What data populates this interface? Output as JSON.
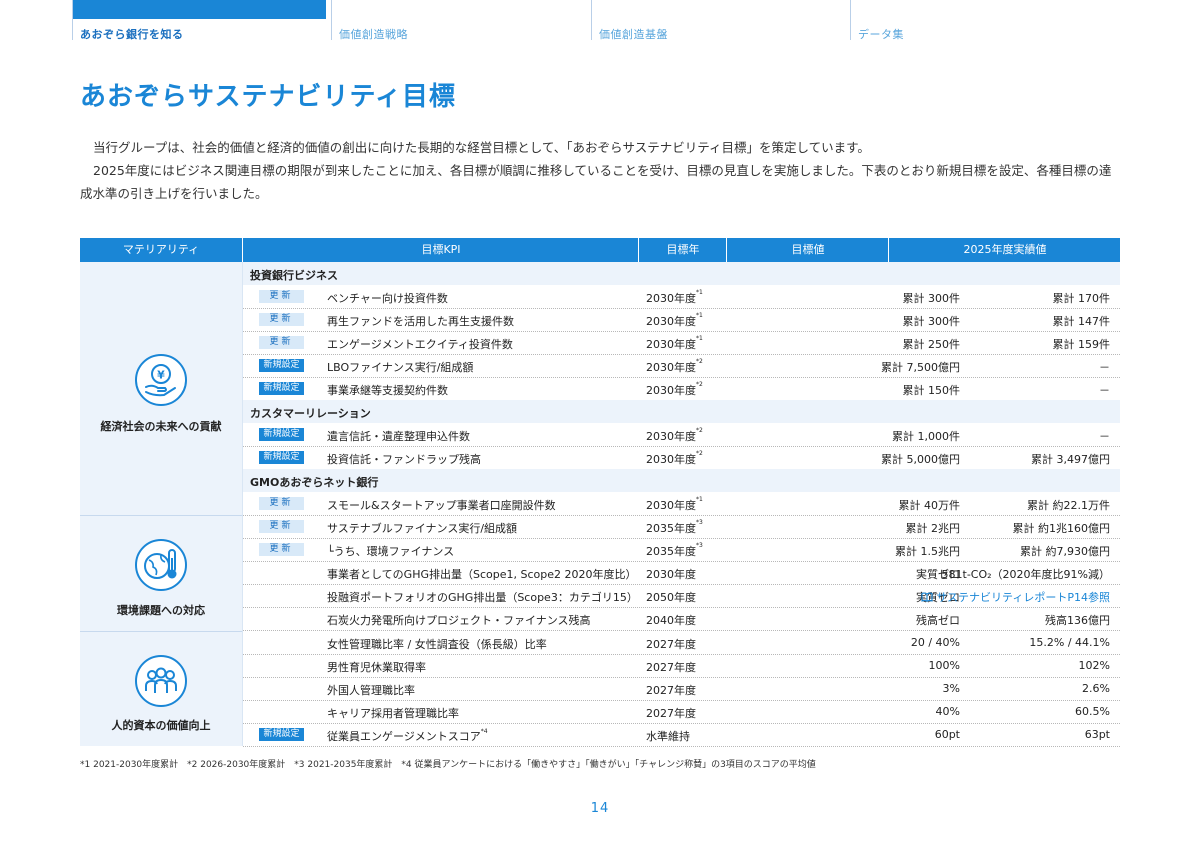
{
  "nav": {
    "tabs": [
      {
        "label": "あおぞら銀行を知る",
        "active": true
      },
      {
        "label": "価値創造戦略",
        "active": false
      },
      {
        "label": "価値創造基盤",
        "active": false
      },
      {
        "label": "データ集",
        "active": false
      }
    ]
  },
  "title": "あおぞらサステナビリティ目標",
  "intro": {
    "p1": "当行グループは、社会的価値と経済的価値の創出に向けた長期的な経営目標として、「あおぞらサステナビリティ目標」を策定しています。",
    "p2": "2025年度にはビジネス関連目標の期限が到来したことに加え、各目標が順調に推移していることを受け、目標の見直しを実施しました。下表のとおり新規目標を設定、各種目標の達成水準の引き上げを行いました。"
  },
  "table": {
    "headers": [
      "マテリアリティ",
      "目標KPI",
      "目標年",
      "目標値",
      "2025年度実績値"
    ],
    "materiality": [
      {
        "label": "経済社会の未来への貢献",
        "icon": "yen-hand-icon"
      },
      {
        "label": "環境課題への対応",
        "icon": "globe-thermometer-icon"
      },
      {
        "label": "人的資本の価値向上",
        "icon": "people-icon"
      }
    ],
    "groups": {
      "g1": "投資銀行ビジネス",
      "g2": "カスタマーリレーション",
      "g3": "GMOあおぞらネット銀行"
    },
    "badges": {
      "update": "更新",
      "new": "新規設定"
    },
    "rows": [
      {
        "kpi": "ベンチャー向け投資件数",
        "year": "2030年度",
        "note": "*1",
        "target": "累計 300件",
        "result": "累計 170件"
      },
      {
        "kpi": "再生ファンドを活用した再生支援件数",
        "year": "2030年度",
        "note": "*1",
        "target": "累計 300件",
        "result": "累計 147件"
      },
      {
        "kpi": "エンゲージメントエクイティ投資件数",
        "year": "2030年度",
        "note": "*1",
        "target": "累計 250件",
        "result": "累計 159件"
      },
      {
        "kpi": "LBOファイナンス実行/組成額",
        "year": "2030年度",
        "note": "*2",
        "target": "累計 7,500億円",
        "result": "－"
      },
      {
        "kpi": "事業承継等支援契約件数",
        "year": "2030年度",
        "note": "*2",
        "target": "累計 150件",
        "result": "－"
      },
      {
        "kpi": "遺言信託・遺産整理申込件数",
        "year": "2030年度",
        "note": "*2",
        "target": "累計 1,000件",
        "result": "－"
      },
      {
        "kpi": "投資信託・ファンドラップ残高",
        "year": "2030年度",
        "note": "*2",
        "target": "累計 5,000億円",
        "result": "累計 3,497億円"
      },
      {
        "kpi": "スモール&スタートアップ事業者口座開設件数",
        "year": "2030年度",
        "note": "*1",
        "target": "累計 40万件",
        "result": "累計 約22.1万件"
      },
      {
        "kpi": "サステナブルファイナンス実行/組成額",
        "year": "2035年度",
        "note": "*3",
        "target": "累計 2兆円",
        "result": "累計 約1兆160億円"
      },
      {
        "kpi": "└うち、環境ファイナンス",
        "year": "2035年度",
        "note": "*3",
        "target": "累計 1.5兆円",
        "result": "累計 約7,930億円"
      },
      {
        "kpi": "事業者としてのGHG排出量（Scope1, Scope2 2020年度比）",
        "year": "2030年度",
        "note": "",
        "target": "実質ゼロ",
        "result": "581t-CO₂（2020年度比91%減）"
      },
      {
        "kpi": "投融資ポートフォリオのGHG排出量（Scope3：カテゴリ15）",
        "year": "2050年度",
        "note": "",
        "target": "実質ゼロ",
        "result": "サステナビリティレポートP14参照"
      },
      {
        "kpi": "石炭火力発電所向けプロジェクト・ファイナンス残高",
        "year": "2040年度",
        "note": "",
        "target": "残高ゼロ",
        "result": "残高136億円"
      },
      {
        "kpi": "女性管理職比率 / 女性調査役（係長級）比率",
        "year": "2027年度",
        "note": "",
        "target": "20 / 40%",
        "result": "15.2% / 44.1%"
      },
      {
        "kpi": "男性育児休業取得率",
        "year": "2027年度",
        "note": "",
        "target": "100%",
        "result": "102%"
      },
      {
        "kpi": "外国人管理職比率",
        "year": "2027年度",
        "note": "",
        "target": "3%",
        "result": "2.6%"
      },
      {
        "kpi": "キャリア採用者管理職比率",
        "year": "2027年度",
        "note": "",
        "target": "40%",
        "result": "60.5%"
      },
      {
        "kpi": "従業員エンゲージメントスコア",
        "kpi_note": "*4",
        "year": "水準維持",
        "note": "",
        "target": "60pt",
        "result": "63pt"
      }
    ]
  },
  "footnote": "*1 2021-2030年度累計　*2 2026-2030年度累計　*3 2021-2035年度累計　*4 従業員アンケートにおける「働きやすさ」「働きがい」「チャレンジ称賛」の3項目のスコアの平均値",
  "page_number": "14",
  "colors": {
    "accent": "#1a86d6",
    "light": "#ecf3fb"
  }
}
